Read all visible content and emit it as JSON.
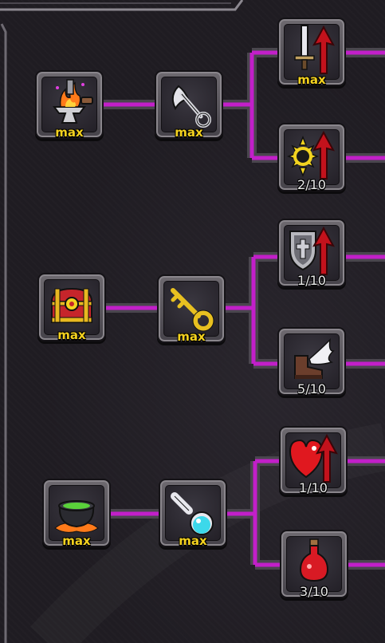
{
  "colors": {
    "link": "#c21fc9",
    "max_label": "#f4d21f",
    "level_label": "#e8e8e8",
    "background": "#1f1c22"
  },
  "groups": [
    {
      "base": {
        "name": "forge-anvil-icon",
        "label": "max"
      },
      "mid": {
        "name": "white-axe-icon",
        "label": "max"
      },
      "upgrades": [
        {
          "name": "sword-attack-up-icon",
          "label": "max"
        },
        {
          "name": "sun-critical-up-icon",
          "label": "2/10"
        }
      ]
    },
    {
      "base": {
        "name": "treasure-chest-icon",
        "label": "max"
      },
      "mid": {
        "name": "golden-key-icon",
        "label": "max"
      },
      "upgrades": [
        {
          "name": "shield-defense-up-icon",
          "label": "1/10"
        },
        {
          "name": "winged-boot-icon",
          "label": "5/10"
        }
      ]
    },
    {
      "base": {
        "name": "cauldron-icon",
        "label": "max"
      },
      "mid": {
        "name": "potion-flask-icon",
        "label": "max"
      },
      "upgrades": [
        {
          "name": "heart-hp-up-icon",
          "label": "1/10"
        },
        {
          "name": "red-potion-icon",
          "label": "3/10"
        }
      ]
    }
  ]
}
